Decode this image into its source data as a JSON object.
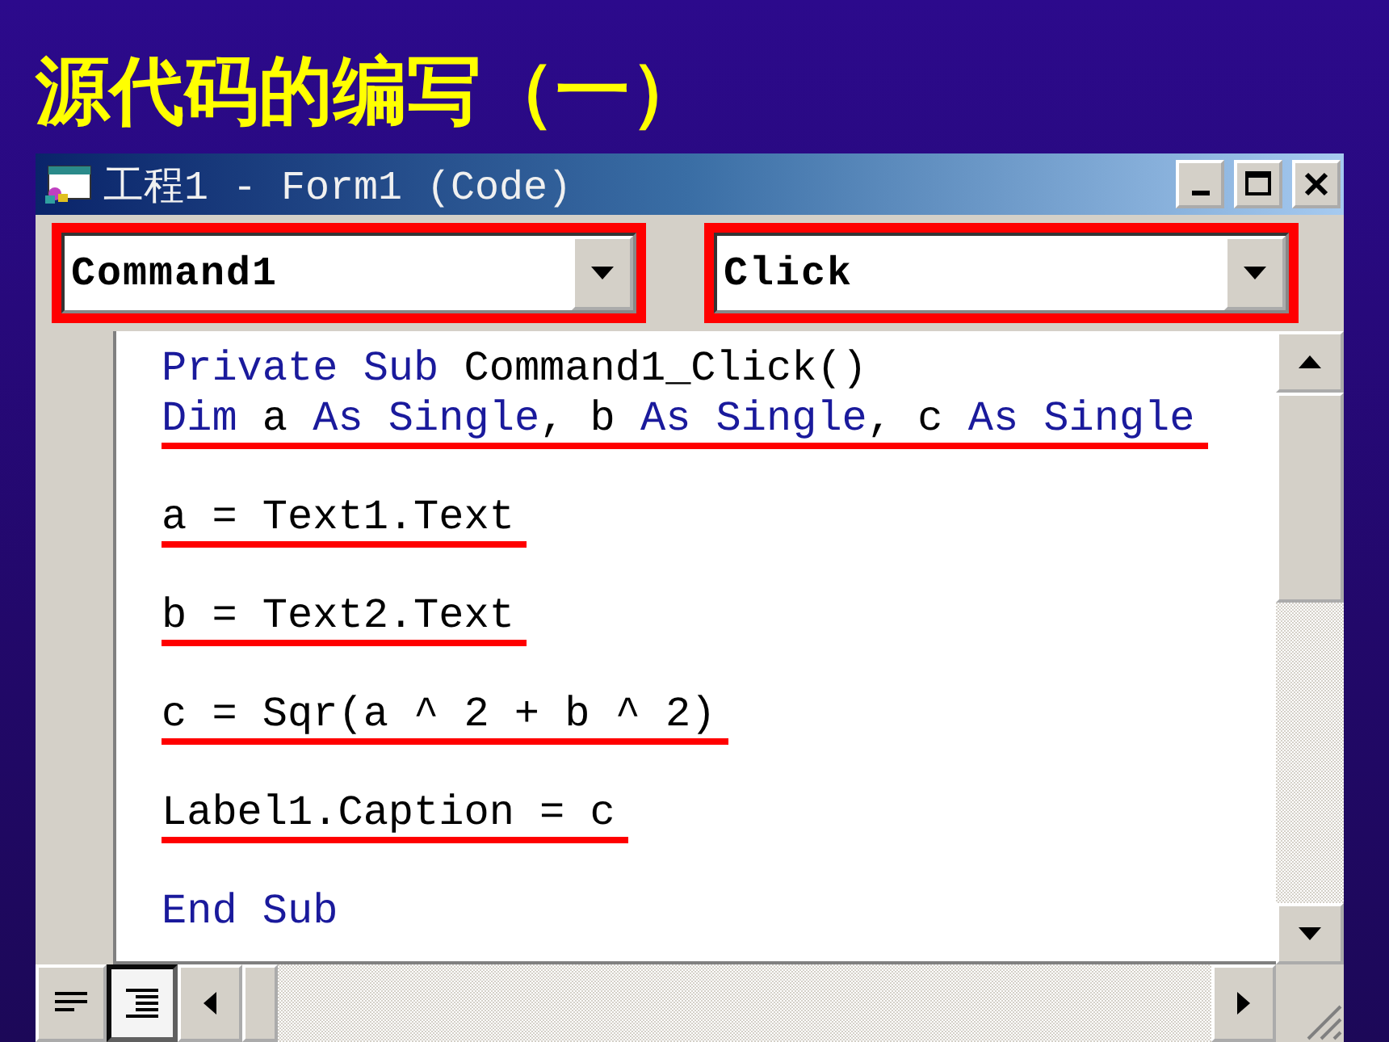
{
  "slide_title": "源代码的编写（一）",
  "window": {
    "title": "工程1 - Form1 (Code)"
  },
  "dropdowns": [
    {
      "value": "Command1",
      "highlighted": true
    },
    {
      "value": "Click",
      "highlighted": true
    }
  ],
  "code_groups": [
    {
      "lines": [
        {
          "underlined": false,
          "tokens": [
            {
              "text": "Private Sub",
              "kind": "keyword"
            },
            {
              "text": " Command1_Click()",
              "kind": "plain"
            }
          ]
        },
        {
          "underlined": true,
          "tokens": [
            {
              "text": "Dim",
              "kind": "keyword"
            },
            {
              "text": " a ",
              "kind": "plain"
            },
            {
              "text": "As Single",
              "kind": "keyword"
            },
            {
              "text": ", b ",
              "kind": "plain"
            },
            {
              "text": "As Single",
              "kind": "keyword"
            },
            {
              "text": ", c ",
              "kind": "plain"
            },
            {
              "text": "As Single",
              "kind": "keyword"
            }
          ]
        }
      ]
    },
    {
      "lines": [
        {
          "underlined": true,
          "tokens": [
            {
              "text": "a = Text1.Text",
              "kind": "plain"
            }
          ]
        }
      ]
    },
    {
      "lines": [
        {
          "underlined": true,
          "tokens": [
            {
              "text": "b = Text2.Text",
              "kind": "plain"
            }
          ]
        }
      ]
    },
    {
      "lines": [
        {
          "underlined": true,
          "tokens": [
            {
              "text": "c = Sqr(a ^ 2 + b ^ 2)",
              "kind": "plain"
            }
          ]
        }
      ]
    },
    {
      "lines": [
        {
          "underlined": true,
          "tokens": [
            {
              "text": "Label1.Caption = c",
              "kind": "plain"
            }
          ]
        }
      ]
    },
    {
      "lines": [
        {
          "underlined": false,
          "tokens": [
            {
              "text": "End Sub",
              "kind": "keyword"
            }
          ]
        }
      ]
    }
  ],
  "view_buttons": [
    {
      "kind": "procedure",
      "selected": false
    },
    {
      "kind": "module",
      "selected": true
    }
  ]
}
